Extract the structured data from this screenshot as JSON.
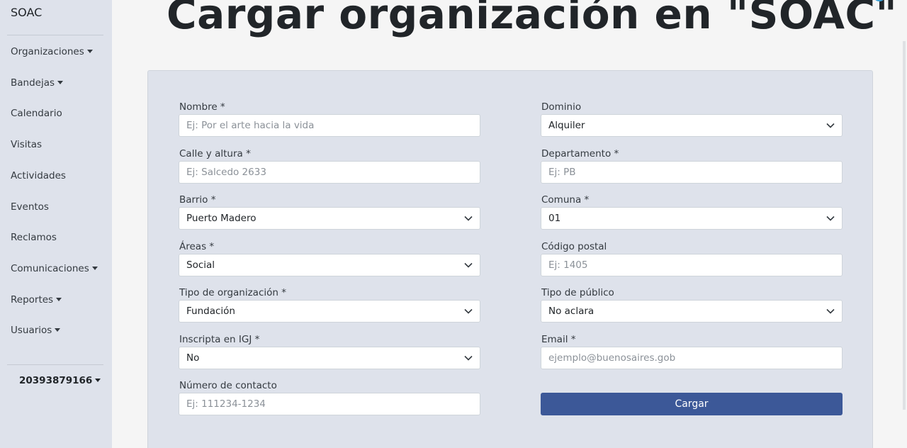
{
  "sidebar": {
    "brand": "SOAC",
    "items": [
      {
        "label": "Organizaciones",
        "dropdown": true
      },
      {
        "label": "Bandejas",
        "dropdown": true
      },
      {
        "label": "Calendario",
        "dropdown": false
      },
      {
        "label": "Visitas",
        "dropdown": false
      },
      {
        "label": "Actividades",
        "dropdown": false
      },
      {
        "label": "Eventos",
        "dropdown": false
      },
      {
        "label": "Reclamos",
        "dropdown": false
      },
      {
        "label": "Comunicaciones",
        "dropdown": true
      },
      {
        "label": "Reportes",
        "dropdown": true
      },
      {
        "label": "Usuarios",
        "dropdown": true
      }
    ],
    "user": "20393879166"
  },
  "page": {
    "title": "Cargar organización en \"SOAC\""
  },
  "form": {
    "nombre": {
      "label": "Nombre *",
      "placeholder": "Ej: Por el arte hacia la vida"
    },
    "calle": {
      "label": "Calle y altura *",
      "placeholder": "Ej: Salcedo 2633"
    },
    "barrio": {
      "label": "Barrio *",
      "value": "Puerto Madero"
    },
    "areas": {
      "label": "Áreas *",
      "value": "Social"
    },
    "tipo_org": {
      "label": "Tipo de organización *",
      "value": "Fundación"
    },
    "igj": {
      "label": "Inscripta en IGJ *",
      "value": "No"
    },
    "contacto": {
      "label": "Número de contacto",
      "placeholder": "Ej: 111234-1234"
    },
    "dominio": {
      "label": "Dominio",
      "value": "Alquiler"
    },
    "departamento": {
      "label": "Departamento *",
      "placeholder": "Ej: PB"
    },
    "comuna": {
      "label": "Comuna *",
      "value": "01"
    },
    "codigo_postal": {
      "label": "Código postal",
      "placeholder": "Ej: 1405"
    },
    "tipo_publico": {
      "label": "Tipo de público",
      "value": "No aclara"
    },
    "email": {
      "label": "Email *",
      "placeholder": "ejemplo@buenosaires.gob"
    },
    "submit_label": "Cargar"
  },
  "colors": {
    "sidebar_bg": "#dee2eb",
    "card_bg": "#dee2eb",
    "primary_button": "#3c5898",
    "page_bg": "#f5f5f5"
  }
}
